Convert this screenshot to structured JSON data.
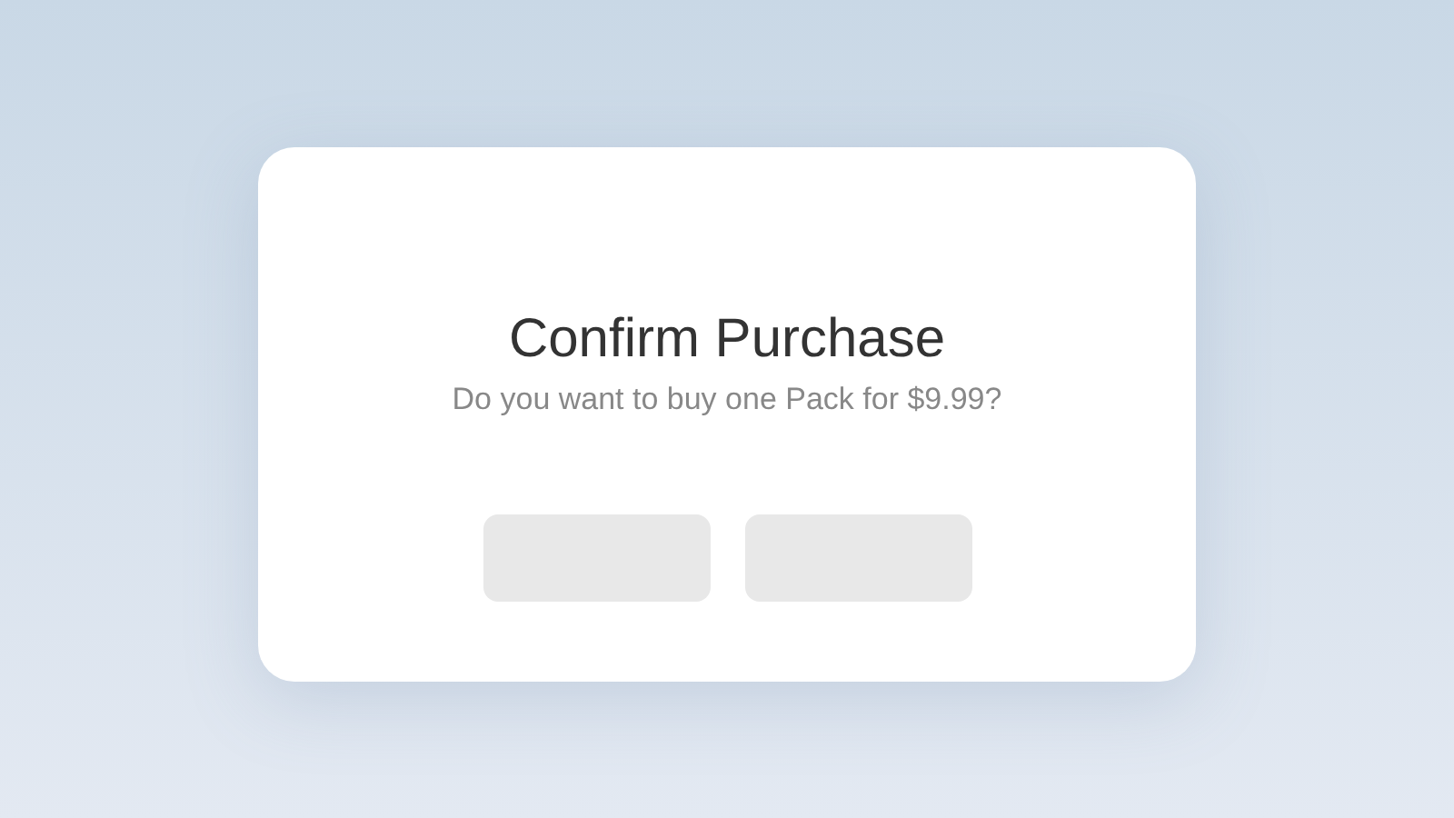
{
  "dialog": {
    "title": "Confirm Purchase",
    "message": "Do you want to buy one Pack for $9.99?",
    "buttons": [
      {
        "kind": "blank"
      },
      {
        "kind": "blank"
      }
    ]
  }
}
